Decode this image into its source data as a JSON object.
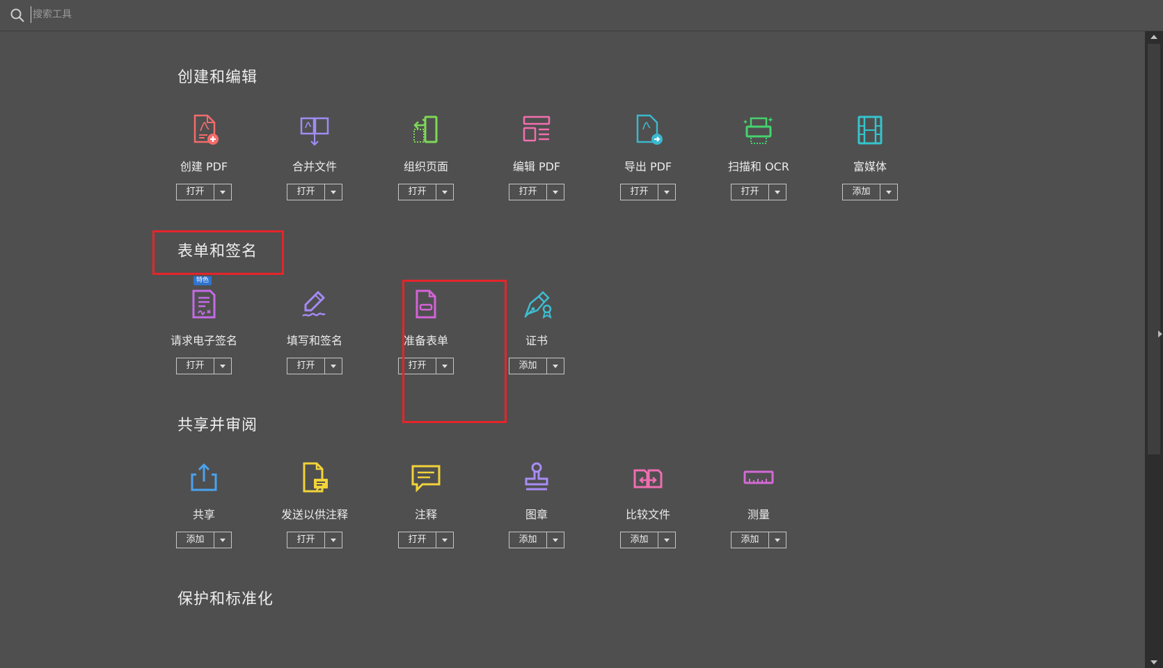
{
  "search": {
    "placeholder": "搜索工具"
  },
  "sections": [
    {
      "title": "创建和编辑",
      "tools": [
        {
          "name": "创建 PDF",
          "button": "打开",
          "icon": "create-pdf-icon",
          "color": "#f36b6b"
        },
        {
          "name": "合并文件",
          "button": "打开",
          "icon": "combine-files-icon",
          "color": "#9f8cf6"
        },
        {
          "name": "组织页面",
          "button": "打开",
          "icon": "organize-pages-icon",
          "color": "#7ed957"
        },
        {
          "name": "编辑 PDF",
          "button": "打开",
          "icon": "edit-pdf-icon",
          "color": "#f26fae"
        },
        {
          "name": "导出 PDF",
          "button": "打开",
          "icon": "export-pdf-icon",
          "color": "#3bb8cf"
        },
        {
          "name": "扫描和 OCR",
          "button": "打开",
          "icon": "scan-ocr-icon",
          "color": "#46d36f"
        },
        {
          "name": "富媒体",
          "button": "添加",
          "icon": "rich-media-icon",
          "color": "#34c4cc"
        }
      ]
    },
    {
      "title": "表单和签名",
      "tools": [
        {
          "name": "请求电子签名",
          "button": "打开",
          "icon": "request-esign-icon",
          "color": "#c46be6",
          "badge": "特色"
        },
        {
          "name": "填写和签名",
          "button": "打开",
          "icon": "fill-sign-icon",
          "color": "#a48af5"
        },
        {
          "name": "准备表单",
          "button": "打开",
          "icon": "prepare-form-icon",
          "color": "#d563d8"
        },
        {
          "name": "证书",
          "button": "添加",
          "icon": "certificate-icon",
          "color": "#3dbed2"
        }
      ]
    },
    {
      "title": "共享并审阅",
      "tools": [
        {
          "name": "共享",
          "button": "添加",
          "icon": "share-icon",
          "color": "#4aa3f0"
        },
        {
          "name": "发送以供注释",
          "button": "打开",
          "icon": "send-comment-icon",
          "color": "#f2d33a"
        },
        {
          "name": "注释",
          "button": "打开",
          "icon": "comment-icon",
          "color": "#f2d33a"
        },
        {
          "name": "图章",
          "button": "添加",
          "icon": "stamp-icon",
          "color": "#a88cf5"
        },
        {
          "name": "比较文件",
          "button": "添加",
          "icon": "compare-files-icon",
          "color": "#ef6eb1"
        },
        {
          "name": "测量",
          "button": "添加",
          "icon": "measure-icon",
          "color": "#d36ad6"
        }
      ]
    },
    {
      "title": "保护和标准化",
      "tools": []
    }
  ]
}
